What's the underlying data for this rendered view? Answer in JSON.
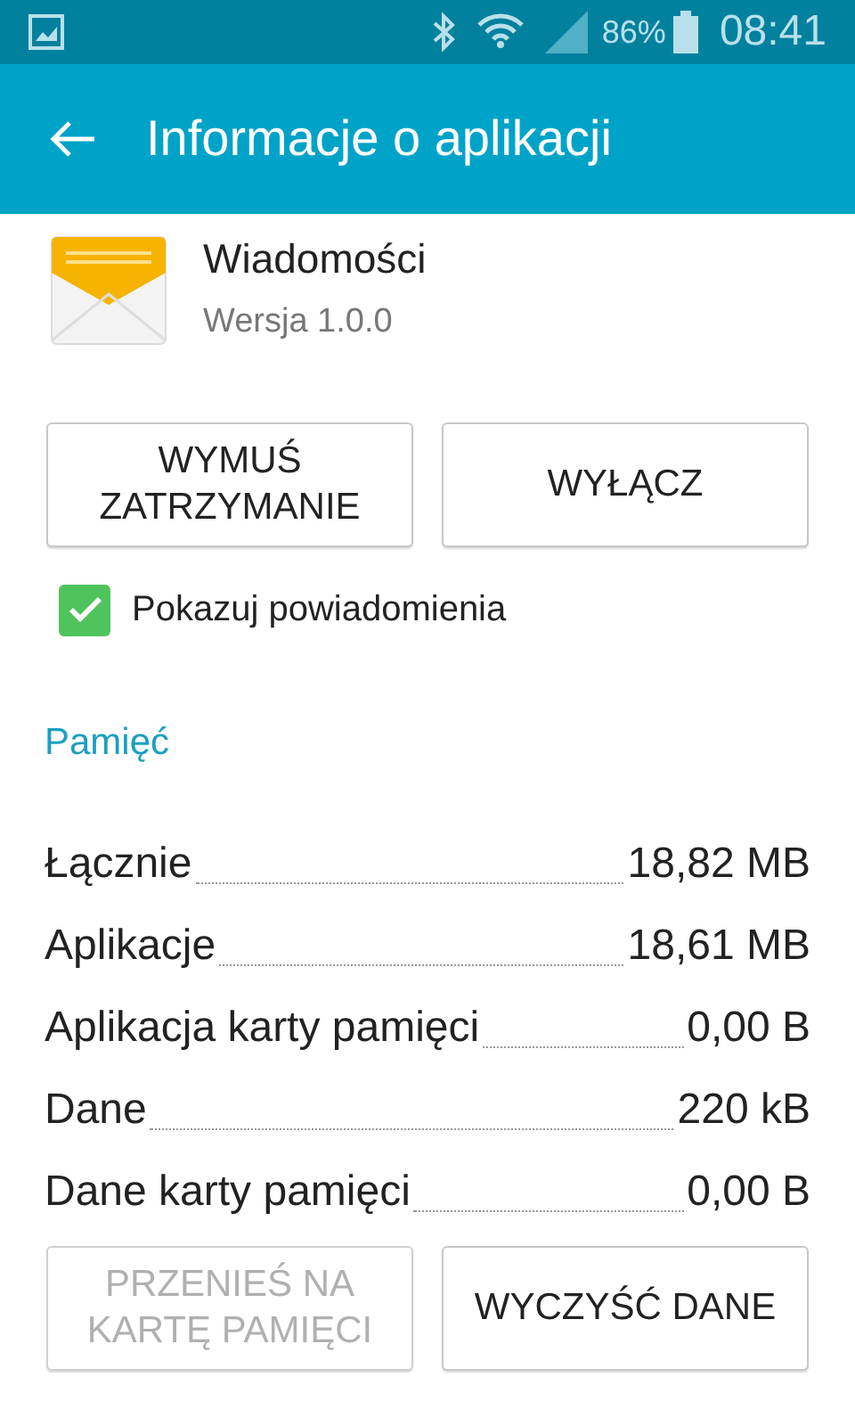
{
  "status_bar": {
    "battery": "86%",
    "time": "08:41"
  },
  "app_bar": {
    "title": "Informacje o aplikacji"
  },
  "app": {
    "name": "Wiadomości",
    "version": "Wersja 1.0.0"
  },
  "top_buttons": [
    {
      "label": "WYMUŚ ZATRZYMANIE",
      "disabled": false
    },
    {
      "label": "WYŁĄCZ",
      "disabled": false
    }
  ],
  "notifications": {
    "label": "Pokazuj powiadomienia",
    "checked": true
  },
  "section": "Pamięć",
  "storage": [
    {
      "label": "Łącznie",
      "value": "18,82 MB"
    },
    {
      "label": "Aplikacje",
      "value": "18,61 MB"
    },
    {
      "label": "Aplikacja karty pamięci",
      "value": "0,00 B"
    },
    {
      "label": "Dane",
      "value": "220 kB"
    },
    {
      "label": "Dane karty pamięci",
      "value": "0,00 B"
    }
  ],
  "bottom_buttons": [
    {
      "label": "PRZENIEŚ NA KARTĘ PAMIĘCI",
      "disabled": true
    },
    {
      "label": "WYCZYŚĆ DANE",
      "disabled": false
    }
  ]
}
